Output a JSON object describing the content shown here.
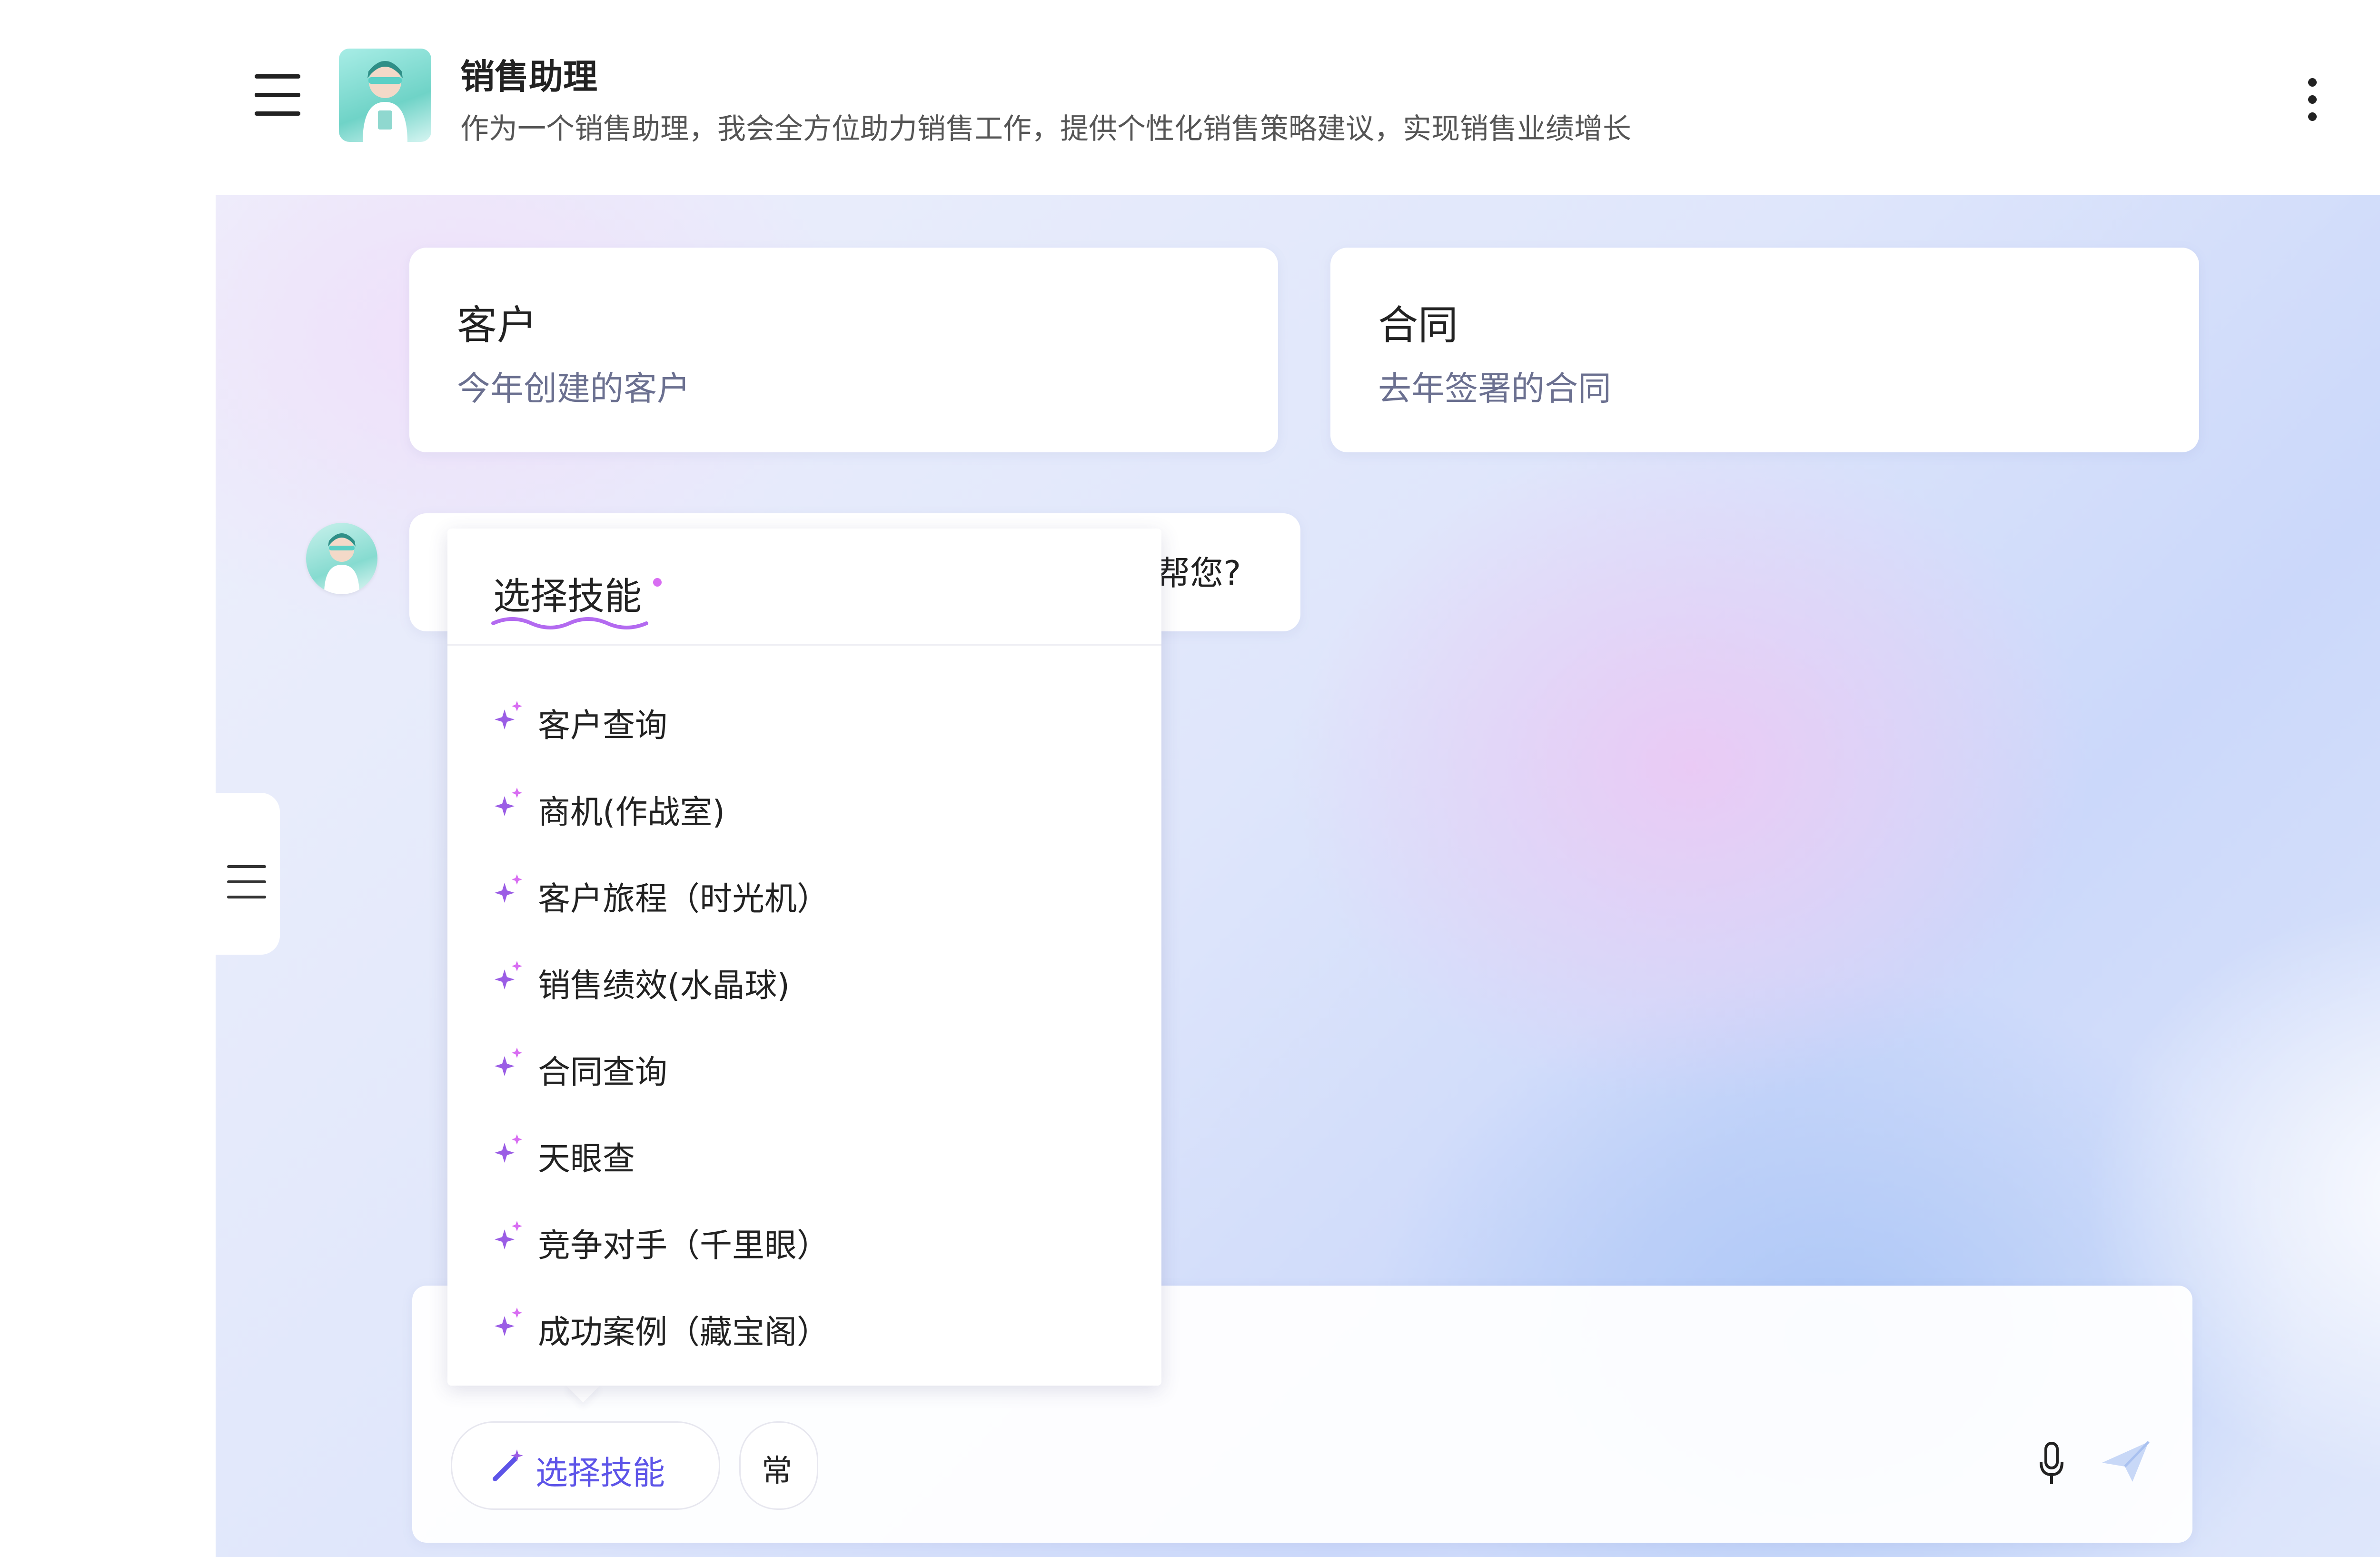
{
  "header": {
    "title": "销售助理",
    "description": "作为一个销售助理，我会全方位助力销售工作，提供个性化销售策略建议，实现销售业绩增长",
    "menu_icon": "hamburger-icon",
    "more_icon": "more-vertical-icon"
  },
  "cards": [
    {
      "title": "客户",
      "subtitle": "今年创建的客户"
    },
    {
      "title": "合同",
      "subtitle": "去年签署的合同"
    }
  ],
  "greeting": {
    "visible_tail": "帮您?"
  },
  "skill_menu": {
    "title": "选择技能",
    "items": [
      {
        "label": "客户查询"
      },
      {
        "label": "商机(作战室)"
      },
      {
        "label": "客户旅程（时光机）"
      },
      {
        "label": "销售绩效(水晶球)"
      },
      {
        "label": "合同查询"
      },
      {
        "label": "天眼查"
      },
      {
        "label": "竞争对手（千里眼）"
      },
      {
        "label": "成功案例（藏宝阁）"
      }
    ]
  },
  "input_bar": {
    "skill_button_label": "选择技能",
    "common_button_label": "常",
    "mic_icon": "microphone-icon",
    "send_icon": "send-icon"
  },
  "colors": {
    "accent": "#5d54e8",
    "sparkle": "#9b5de5",
    "card_bg": "#ffffff"
  }
}
